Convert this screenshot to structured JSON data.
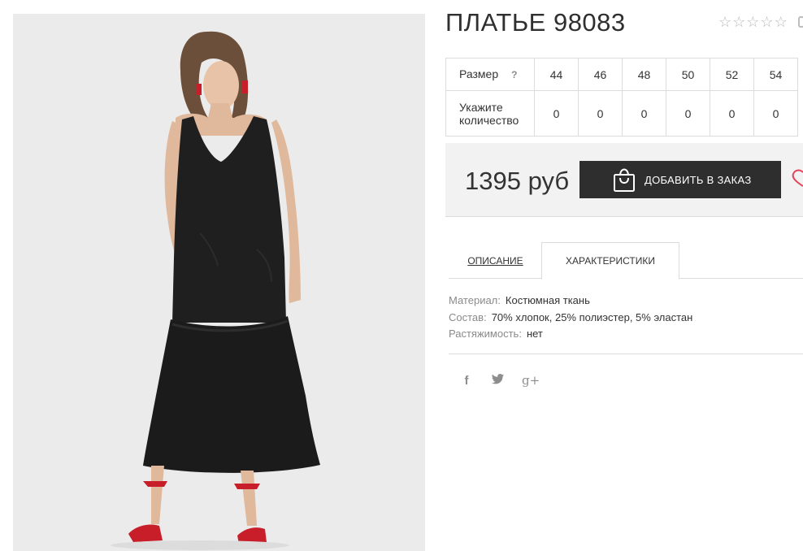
{
  "product": {
    "title": "ПЛАТЬЕ 98083",
    "rating_stars": [
      "☆",
      "☆",
      "☆",
      "☆",
      "☆"
    ],
    "image_icon": "dress-photo"
  },
  "sizes_table": {
    "size_label": "Размер",
    "help": "?",
    "sizes": [
      "44",
      "46",
      "48",
      "50",
      "52",
      "54"
    ],
    "qty_label_line1": "Укажите",
    "qty_label_line2": "количество",
    "quantities": [
      "0",
      "0",
      "0",
      "0",
      "0",
      "0"
    ]
  },
  "buy": {
    "price": "1395 руб",
    "add_to_order": "ДОБАВИТЬ В ЗАКАЗ",
    "bag_icon": "shopping-bag-icon",
    "wishlist_icon": "heart-icon"
  },
  "tabs": {
    "description": "ОПИСАНИЕ",
    "characteristics": "ХАРАКТЕРИСТИКИ"
  },
  "specs": [
    {
      "key": "Материал:",
      "value": "Костюмная ткань"
    },
    {
      "key": "Состав:",
      "value": "70% хлопок, 25% полиэстер, 5% эластан"
    },
    {
      "key": "Растяжимость:",
      "value": "нет"
    }
  ],
  "social": {
    "facebook": "f",
    "twitter": "t",
    "googleplus": "g+"
  },
  "colors": {
    "accent_dark": "#2e2e2e",
    "heart": "#e0455b",
    "shoe_red": "#c81e2a"
  }
}
